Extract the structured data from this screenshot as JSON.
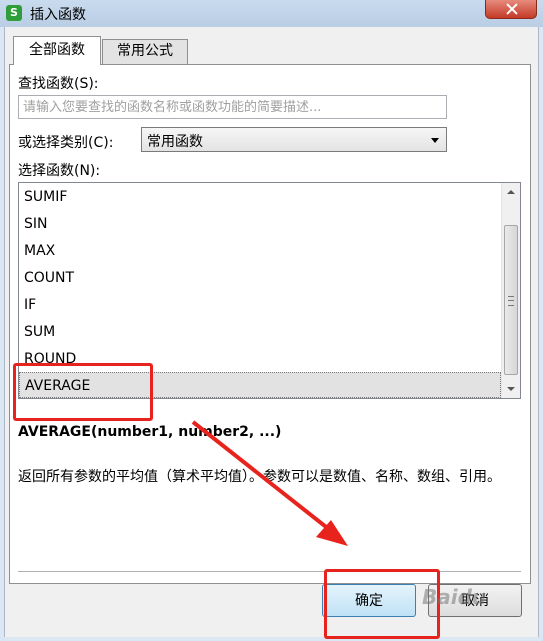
{
  "window": {
    "title": "插入函数",
    "app_icon_letter": "S",
    "close_icon": "close-icon"
  },
  "tabs": [
    {
      "label": "全部函数",
      "active": true
    },
    {
      "label": "常用公式",
      "active": false
    }
  ],
  "search": {
    "label": "查找函数(S):",
    "value": "",
    "placeholder": "请输入您要查找的函数名称或函数功能的简要描述..."
  },
  "category": {
    "label": "或选择类别(C):",
    "selected": "常用函数"
  },
  "function_list": {
    "label": "选择函数(N):",
    "items": [
      "SUMIF",
      "SIN",
      "MAX",
      "COUNT",
      "IF",
      "SUM",
      "ROUND",
      "AVERAGE"
    ],
    "selected": "AVERAGE"
  },
  "signature": "AVERAGE(number1, number2, ...)",
  "description": "返回所有参数的平均值（算术平均值）。参数可以是数值、名称、数组、引用。",
  "buttons": {
    "ok": "确定",
    "cancel": "取消"
  },
  "colors": {
    "annotation": "#e8231e",
    "selection": "#e2e2e2",
    "title_bar": "#c9dbee"
  },
  "watermark": "Baidu"
}
